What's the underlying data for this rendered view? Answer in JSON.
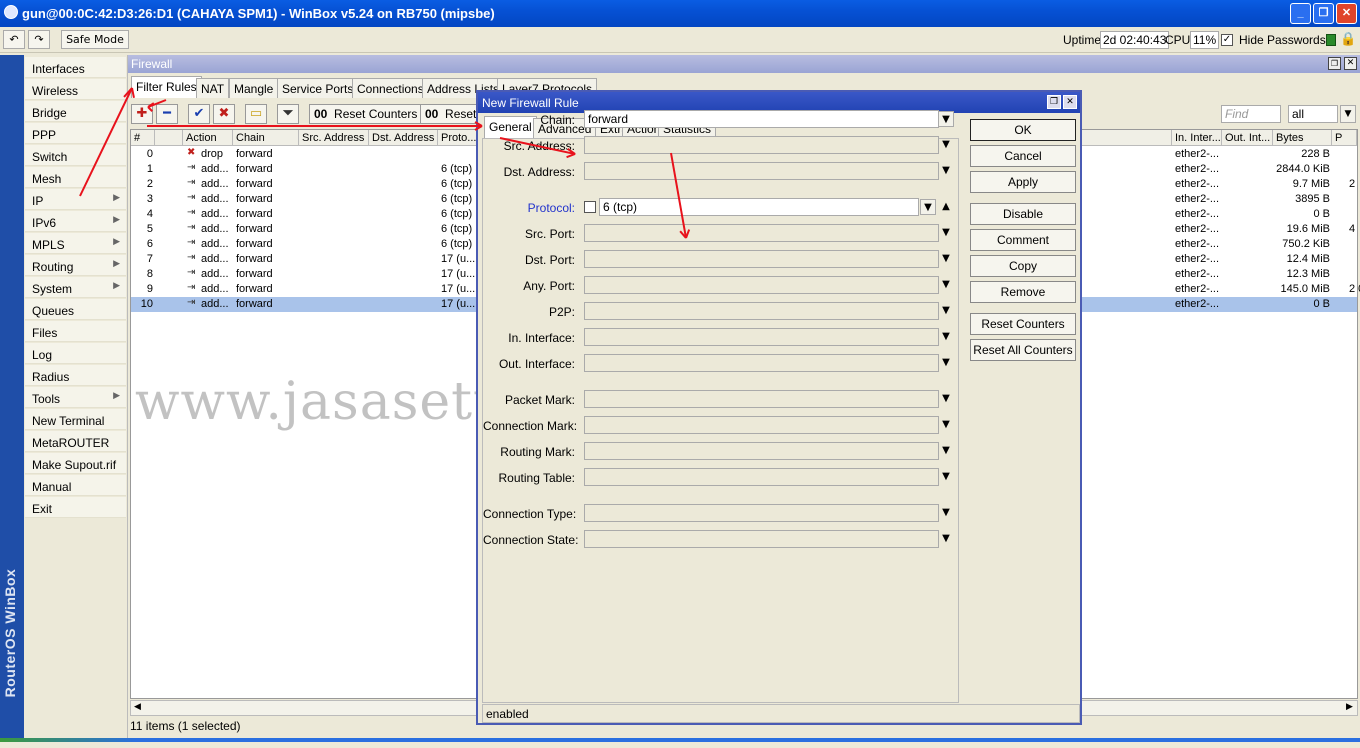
{
  "window": {
    "title": "gun@00:0C:42:D3:26:D1 (CAHAYA SPM1) - WinBox v5.24 on RB750 (mipsbe)"
  },
  "toolbar": {
    "safe_mode": "Safe Mode",
    "uptime_label": "Uptime:",
    "uptime_value": "2d 02:40:43",
    "cpu_label": "CPU:",
    "cpu_value": "11%",
    "hide_passwords": "Hide Passwords"
  },
  "sidebar": {
    "brand": "RouterOS WinBox",
    "items": [
      {
        "label": "Interfaces"
      },
      {
        "label": "Wireless"
      },
      {
        "label": "Bridge"
      },
      {
        "label": "PPP"
      },
      {
        "label": "Switch"
      },
      {
        "label": "Mesh"
      },
      {
        "label": "IP"
      },
      {
        "label": "IPv6"
      },
      {
        "label": "MPLS"
      },
      {
        "label": "Routing"
      },
      {
        "label": "System"
      },
      {
        "label": "Queues"
      },
      {
        "label": "Files"
      },
      {
        "label": "Log"
      },
      {
        "label": "Radius"
      },
      {
        "label": "Tools"
      },
      {
        "label": "New Terminal"
      },
      {
        "label": "MetaROUTER"
      },
      {
        "label": "Make Supout.rif"
      },
      {
        "label": "Manual"
      },
      {
        "label": "Exit"
      }
    ]
  },
  "firewall": {
    "title": "Firewall",
    "tabs": [
      "Filter Rules",
      "NAT",
      "Mangle",
      "Service Ports",
      "Connections",
      "Address Lists",
      "Layer7 Protocols"
    ],
    "reset_counters": "Reset Counters",
    "reset_all": "Reset",
    "counter_prefix": "00",
    "find_placeholder": "Find",
    "filter_value": "all",
    "columns": [
      "#",
      "Action",
      "Chain",
      "Src. Address",
      "Dst. Address",
      "Proto...",
      "In. Inter...",
      "Out. Int...",
      "Bytes",
      "P"
    ],
    "rows": [
      {
        "num": "0",
        "action": "drop",
        "chain": "forward",
        "proto": "",
        "in": "ether2-...",
        "bytes": "228 B",
        "p": ""
      },
      {
        "num": "1",
        "action": "add...",
        "chain": "forward",
        "proto": "6 (tcp)",
        "in": "ether2-...",
        "bytes": "2844.0 KiB",
        "p": ""
      },
      {
        "num": "2",
        "action": "add...",
        "chain": "forward",
        "proto": "6 (tcp)",
        "in": "ether2-...",
        "bytes": "9.7 MiB",
        "p": "2"
      },
      {
        "num": "3",
        "action": "add...",
        "chain": "forward",
        "proto": "6 (tcp)",
        "in": "ether2-...",
        "bytes": "3895 B",
        "p": ""
      },
      {
        "num": "4",
        "action": "add...",
        "chain": "forward",
        "proto": "6 (tcp)",
        "in": "ether2-...",
        "bytes": "0 B",
        "p": ""
      },
      {
        "num": "5",
        "action": "add...",
        "chain": "forward",
        "proto": "6 (tcp)",
        "in": "ether2-...",
        "bytes": "19.6 MiB",
        "p": "4"
      },
      {
        "num": "6",
        "action": "add...",
        "chain": "forward",
        "proto": "6 (tcp)",
        "in": "ether2-...",
        "bytes": "750.2 KiB",
        "p": ""
      },
      {
        "num": "7",
        "action": "add...",
        "chain": "forward",
        "proto": "17 (u...",
        "in": "ether2-...",
        "bytes": "12.4 MiB",
        "p": ""
      },
      {
        "num": "8",
        "action": "add...",
        "chain": "forward",
        "proto": "17 (u...",
        "in": "ether2-...",
        "bytes": "12.3 MiB",
        "p": ""
      },
      {
        "num": "9",
        "action": "add...",
        "chain": "forward",
        "proto": "17 (u...",
        "in": "ether2-...",
        "bytes": "145.0 MiB",
        "p": "2 0"
      },
      {
        "num": "10",
        "action": "add...",
        "chain": "forward",
        "proto": "17 (u...",
        "in": "ether2-...",
        "bytes": "0 B",
        "p": ""
      }
    ],
    "status": "11 items (1 selected)"
  },
  "dialog": {
    "title": "New Firewall Rule",
    "tabs": [
      "General",
      "Advanced",
      "Extra",
      "Action",
      "Statistics"
    ],
    "fields": {
      "chain_label": "Chain:",
      "chain_value": "forward",
      "src_address": "Src. Address:",
      "dst_address": "Dst. Address:",
      "protocol_label": "Protocol:",
      "protocol_value": "6 (tcp)",
      "src_port": "Src. Port:",
      "dst_port": "Dst. Port:",
      "any_port": "Any. Port:",
      "p2p": "P2P:",
      "in_interface": "In. Interface:",
      "out_interface": "Out. Interface:",
      "packet_mark": "Packet Mark:",
      "connection_mark": "Connection Mark:",
      "routing_mark": "Routing Mark:",
      "routing_table": "Routing Table:",
      "connection_type": "Connection Type:",
      "connection_state": "Connection State:"
    },
    "buttons": [
      "OK",
      "Cancel",
      "Apply",
      "Disable",
      "Comment",
      "Copy",
      "Remove",
      "Reset Counters",
      "Reset All Counters"
    ],
    "status": "enabled"
  },
  "watermark": "www.jasasettingmikrotik.web.id",
  "colors": {
    "accent": "#e8121c",
    "title_blue": "#0651d4",
    "selection": "#a9c3ea"
  }
}
